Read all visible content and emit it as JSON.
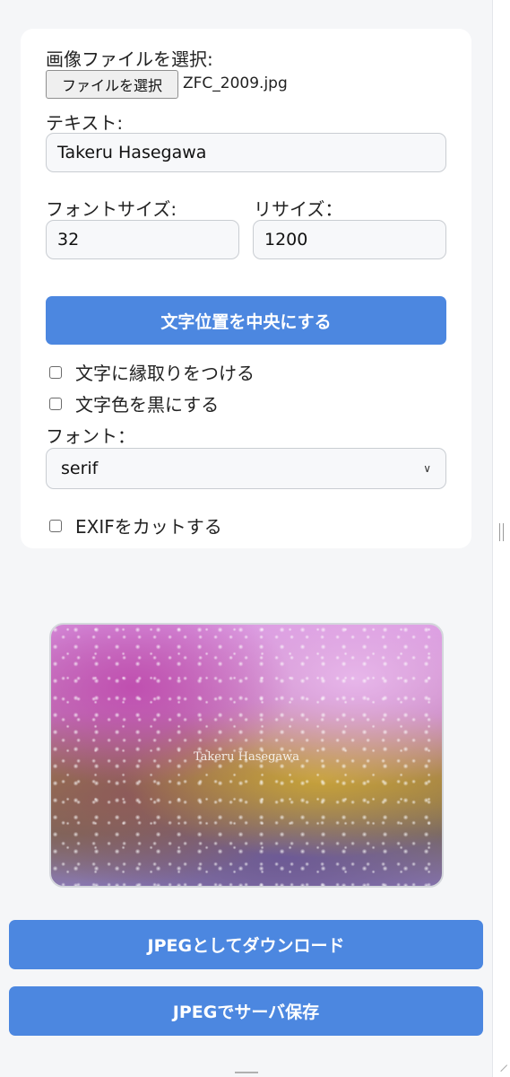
{
  "form": {
    "image_label": "画像ファイルを選択:",
    "file_button": "ファイルを選択",
    "file_name": "ZFC_2009.jpg",
    "text_label": "テキスト:",
    "text_value": "Takeru Hasegawa",
    "font_size_label": "フォントサイズ:",
    "font_size_value": "32",
    "resize_label": "リサイズ：",
    "resize_value": "1200",
    "center_button": "文字位置を中央にする",
    "outline_label": "文字に縁取りをつける",
    "outline_checked": false,
    "black_label": "文字色を黒にする",
    "black_checked": false,
    "font_label": "フォント：",
    "font_value": "serif",
    "exif_label": "EXIFをカットする",
    "exif_checked": false
  },
  "preview": {
    "watermark_text": "Takeru Hasegawa"
  },
  "actions": {
    "download_jpeg": "JPEGとしてダウンロード",
    "save_server": "JPEGでサーバ保存"
  },
  "colors": {
    "accent": "#4c87e0",
    "background": "#f5f6f8",
    "card": "#ffffff"
  }
}
